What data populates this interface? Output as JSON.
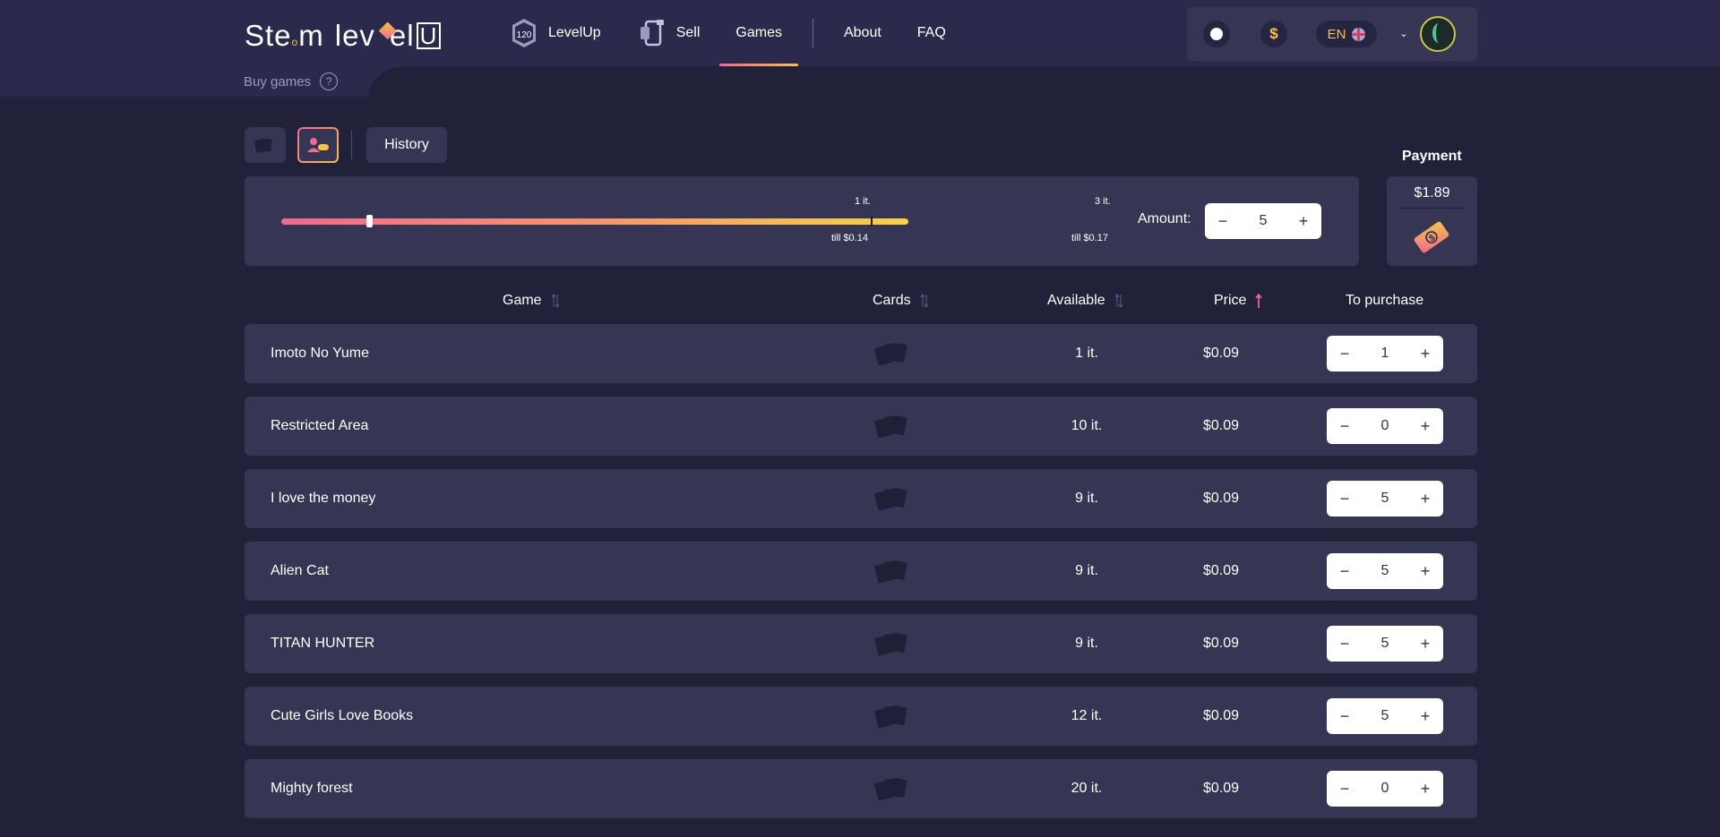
{
  "header": {
    "logo_text_a": "Ste",
    "logo_text_b": "m",
    "logo_text_c": "lev",
    "logo_text_d": "U",
    "nav": {
      "levelup_badge": "120",
      "levelup": "LevelUp",
      "sell": "Sell",
      "games": "Games",
      "about": "About",
      "faq": "FAQ"
    },
    "balance_icon": "dollar-icon",
    "language": "EN"
  },
  "breadcrumb": {
    "label": "Buy games",
    "help": "?"
  },
  "toolbar": {
    "history": "History"
  },
  "slider": {
    "ticks": [
      {
        "top": "1 it.",
        "bottom": "till $0.14"
      },
      {
        "top": "3 it.",
        "bottom": "till $0.17"
      }
    ],
    "amount_label": "Amount:",
    "amount_value": "5",
    "level": 0.14
  },
  "payment": {
    "label": "Payment",
    "amount": "$1.89"
  },
  "table": {
    "columns": {
      "game": "Game",
      "cards": "Cards",
      "available": "Available",
      "price": "Price",
      "to_purchase": "To purchase"
    },
    "rows": [
      {
        "name": "Imoto No Yume",
        "available": "1 it.",
        "price": "$0.09",
        "qty": "1"
      },
      {
        "name": "Restricted Area",
        "available": "10 it.",
        "price": "$0.09",
        "qty": "0"
      },
      {
        "name": "I love the money",
        "available": "9 it.",
        "price": "$0.09",
        "qty": "5"
      },
      {
        "name": "Alien Cat",
        "available": "9 it.",
        "price": "$0.09",
        "qty": "5"
      },
      {
        "name": "TITAN HUNTER",
        "available": "9 it.",
        "price": "$0.09",
        "qty": "5"
      },
      {
        "name": "Cute Girls Love Books",
        "available": "12 it.",
        "price": "$0.09",
        "qty": "5"
      },
      {
        "name": "Mighty forest",
        "available": "20 it.",
        "price": "$0.09",
        "qty": "0"
      }
    ]
  },
  "stepper": {
    "minus": "−",
    "plus": "+"
  },
  "colors": {
    "accent_pink": "#ef6a8f",
    "accent_yellow": "#f7c348",
    "panel": "#363554",
    "bg": "#22213a"
  }
}
